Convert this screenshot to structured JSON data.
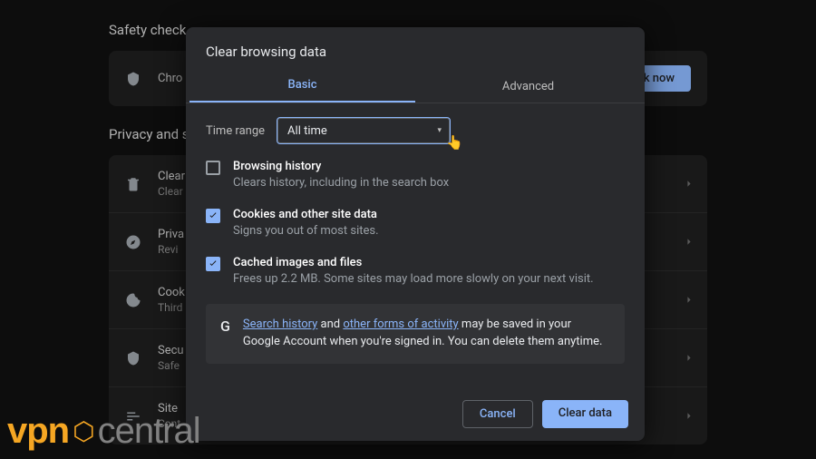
{
  "bg": {
    "section1_title": "Safety check",
    "safety_row": {
      "line1": "Chro",
      "button": "eck now"
    },
    "section2_title": "Privacy and s",
    "rows": [
      {
        "t": "Clear",
        "s": "Clear"
      },
      {
        "t": "Priva",
        "s": "Revi"
      },
      {
        "t": "Cook",
        "s": "Third"
      },
      {
        "t": "Secu",
        "s": "Safe"
      },
      {
        "t": "Site",
        "s": "Cont"
      }
    ]
  },
  "modal": {
    "title": "Clear browsing data",
    "tabs": {
      "basic": "Basic",
      "advanced": "Advanced"
    },
    "time_label": "Time range",
    "time_value": "All time",
    "options": [
      {
        "checked": false,
        "title": "Browsing history",
        "sub": "Clears history, including in the search box"
      },
      {
        "checked": true,
        "title": "Cookies and other site data",
        "sub": "Signs you out of most sites."
      },
      {
        "checked": true,
        "title": "Cached images and files",
        "sub": "Frees up 2.2 MB. Some sites may load more slowly on your next visit."
      }
    ],
    "info": {
      "link1": "Search history",
      "mid": " and ",
      "link2": "other forms of activity",
      "rest": " may be saved in your Google Account when you're signed in. You can delete them anytime."
    },
    "buttons": {
      "cancel": "Cancel",
      "clear": "Clear data"
    }
  },
  "watermark": {
    "a": "vpn",
    "b": "central"
  }
}
